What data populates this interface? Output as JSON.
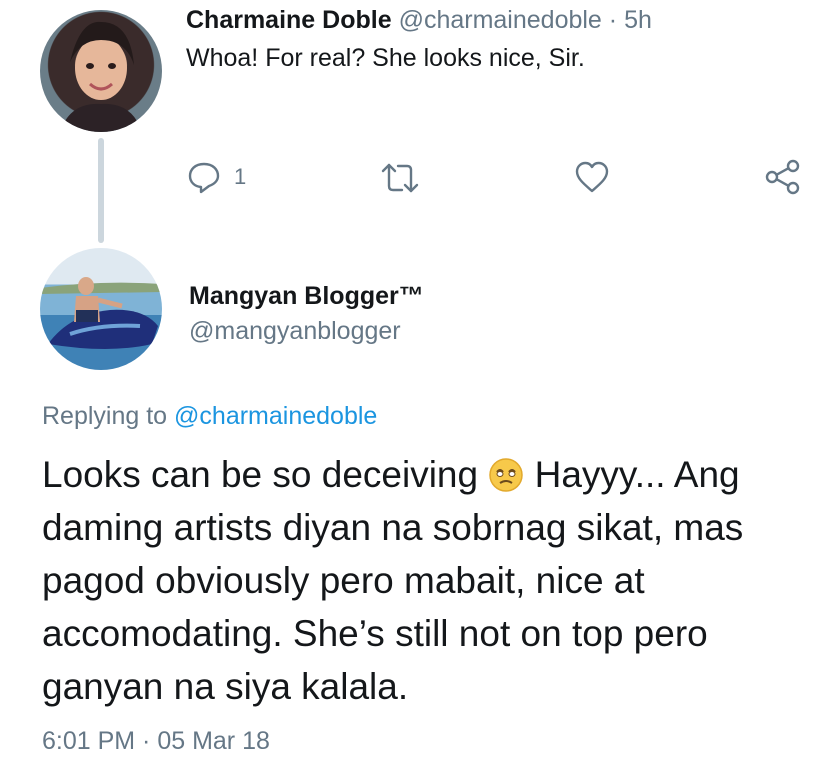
{
  "reply": {
    "display_name": "Charmaine Doble",
    "handle": "@charmainedoble",
    "separator": "·",
    "time_ago": "5h",
    "text": "Whoa! For real? She looks nice, Sir.",
    "actions": {
      "reply_count": "1",
      "reply_icon": "reply-icon",
      "retweet_icon": "retweet-icon",
      "like_icon": "heart-icon",
      "share_icon": "share-icon"
    }
  },
  "main_tweet": {
    "display_name": "Mangyan Blogger™",
    "handle": "@mangyanblogger",
    "replying_prefix": "Replying to",
    "replying_handle": "@charmainedoble",
    "text_before_emoji": "Looks can be so deceiving ",
    "text_after_emoji": " Hayyy... Ang daming artists diyan na sobrnag sikat, mas pagod obviously pero mabait, nice at accomodating. She’s still not on top pero ganyan na siya kalala.",
    "emoji": "😩",
    "timestamp": "6:01 PM · 05 Mar 18"
  },
  "colors": {
    "text": "#14171a",
    "muted": "#657786",
    "link": "#1b95e0",
    "thread_line": "#ccd6dd"
  }
}
